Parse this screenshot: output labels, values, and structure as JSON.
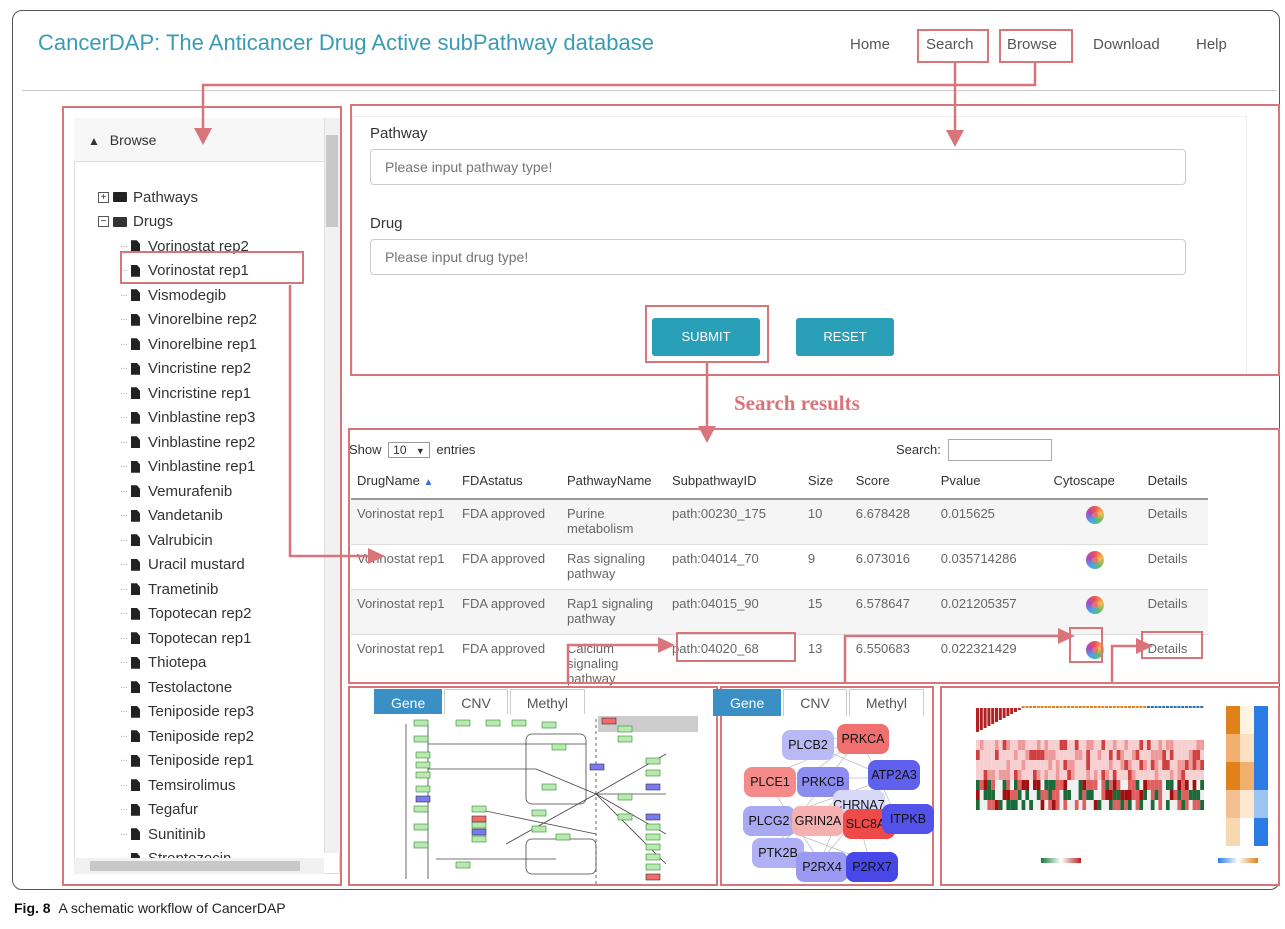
{
  "header": {
    "title": "CancerDAP: The Anticancer Drug Active subPathway database",
    "nav": [
      "Home",
      "Search",
      "Browse",
      "Download",
      "Help"
    ]
  },
  "browse": {
    "heading": "Browse",
    "tree_pathways": "Pathways",
    "tree_drugs": "Drugs",
    "drugs": [
      "Vorinostat rep2",
      "Vorinostat rep1",
      "Vismodegib",
      "Vinorelbine rep2",
      "Vinorelbine rep1",
      "Vincristine rep2",
      "Vincristine rep1",
      "Vinblastine rep3",
      "Vinblastine rep2",
      "Vinblastine rep1",
      "Vemurafenib",
      "Vandetanib",
      "Valrubicin",
      "Uracil mustard",
      "Trametinib",
      "Topotecan rep2",
      "Topotecan rep1",
      "Thiotepa",
      "Testolactone",
      "Teniposide rep3",
      "Teniposide rep2",
      "Teniposide rep1",
      "Temsirolimus",
      "Tegafur",
      "Sunitinib",
      "Streptozocin"
    ]
  },
  "search_form": {
    "pathway_label": "Pathway",
    "pathway_placeholder": "Please input pathway type!",
    "drug_label": "Drug",
    "drug_placeholder": "Please input drug type!",
    "submit": "SUBMIT",
    "reset": "RESET"
  },
  "results": {
    "title": "Search results",
    "show_prefix": "Show",
    "show_value": "10",
    "show_suffix": "entries",
    "search_label": "Search:",
    "columns": [
      "DrugName",
      "FDAstatus",
      "PathwayName",
      "SubpathwayID",
      "Size",
      "Score",
      "Pvalue",
      "Cytoscape",
      "Details"
    ],
    "rows": [
      {
        "drug": "Vorinostat rep1",
        "fda": "FDA approved",
        "pathway": "Purine metabolism",
        "id": "path:00230_175",
        "size": "10",
        "score": "6.678428",
        "pvalue": "0.015625",
        "details": "Details"
      },
      {
        "drug": "Vorinostat rep1",
        "fda": "FDA approved",
        "pathway": "Ras signaling pathway",
        "id": "path:04014_70",
        "size": "9",
        "score": "6.073016",
        "pvalue": "0.035714286",
        "details": "Details"
      },
      {
        "drug": "Vorinostat rep1",
        "fda": "FDA approved",
        "pathway": "Rap1 signaling pathway",
        "id": "path:04015_90",
        "size": "15",
        "score": "6.578647",
        "pvalue": "0.021205357",
        "details": "Details"
      },
      {
        "drug": "Vorinostat rep1",
        "fda": "FDA approved",
        "pathway": "Calcium signaling pathway",
        "id": "path:04020_68",
        "size": "13",
        "score": "6.550683",
        "pvalue": "0.022321429",
        "details": "Details"
      }
    ]
  },
  "tabs": [
    "Gene",
    "CNV",
    "Methyl"
  ],
  "network": {
    "nodes": [
      {
        "label": "PLCB2",
        "color": "#b9b9f5"
      },
      {
        "label": "PRKCA",
        "color": "#f07070"
      },
      {
        "label": "PLCE1",
        "color": "#f48a8a"
      },
      {
        "label": "PRKCB",
        "color": "#8d8df0"
      },
      {
        "label": "ATP2A3",
        "color": "#6060ee"
      },
      {
        "label": "CHRNA7",
        "color": "#d8d8f8"
      },
      {
        "label": "PLCG2",
        "color": "#a9a9f3"
      },
      {
        "label": "GRIN2A",
        "color": "#f6b0b0"
      },
      {
        "label": "SLC8A1",
        "color": "#ee4a4a"
      },
      {
        "label": "ITPKB",
        "color": "#5252ea"
      },
      {
        "label": "PTK2B",
        "color": "#b0b0f4"
      },
      {
        "label": "P2RX4",
        "color": "#9a9af2"
      },
      {
        "label": "P2RX7",
        "color": "#4848e8"
      }
    ]
  },
  "caption": {
    "fig": "Fig. 8",
    "text": "A schematic workflow of CancerDAP"
  }
}
